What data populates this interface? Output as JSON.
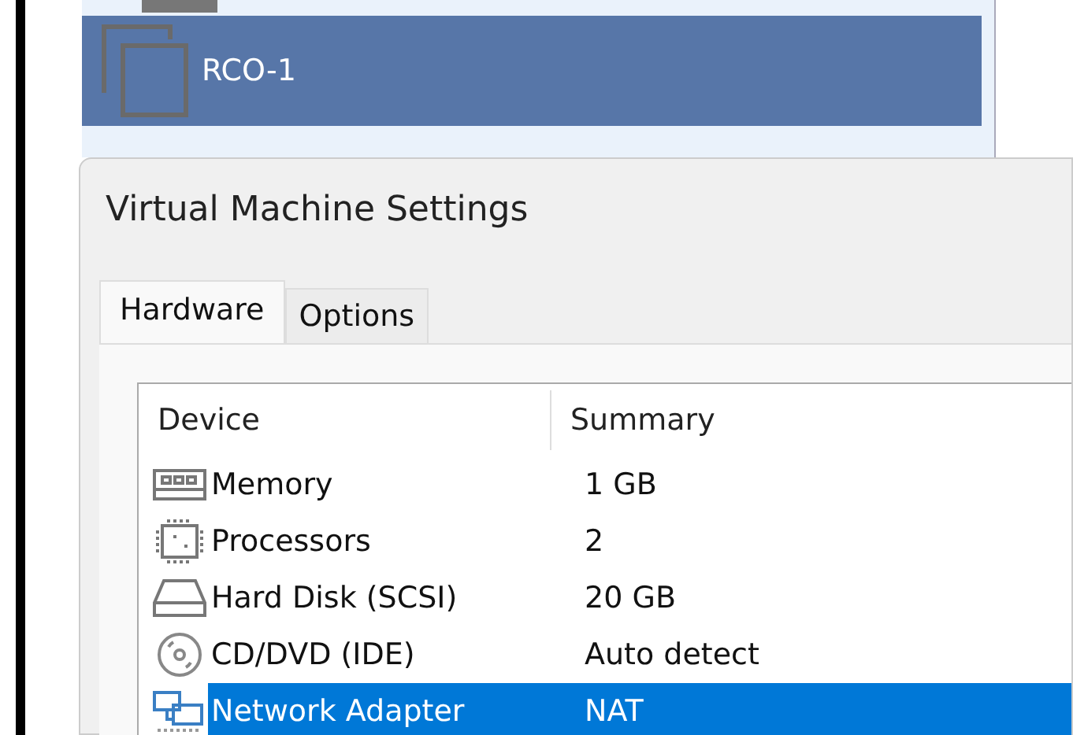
{
  "vm_list": {
    "items": [
      {
        "name": "RCO-1",
        "selected": true
      }
    ]
  },
  "dialog": {
    "title": "Virtual Machine Settings",
    "tabs": [
      {
        "label": "Hardware",
        "selected": true
      },
      {
        "label": "Options",
        "selected": false
      }
    ],
    "table": {
      "columns": [
        "Device",
        "Summary"
      ],
      "rows": [
        {
          "kind": "memory",
          "device": "Memory",
          "summary": "1 GB",
          "selected": false
        },
        {
          "kind": "processor",
          "device": "Processors",
          "summary": "2",
          "selected": false
        },
        {
          "kind": "disk",
          "device": "Hard Disk (SCSI)",
          "summary": "20 GB",
          "selected": false
        },
        {
          "kind": "cd",
          "device": "CD/DVD (IDE)",
          "summary": "Auto detect",
          "selected": false
        },
        {
          "kind": "network",
          "device": "Network Adapter",
          "summary": "NAT",
          "selected": true
        }
      ]
    }
  }
}
